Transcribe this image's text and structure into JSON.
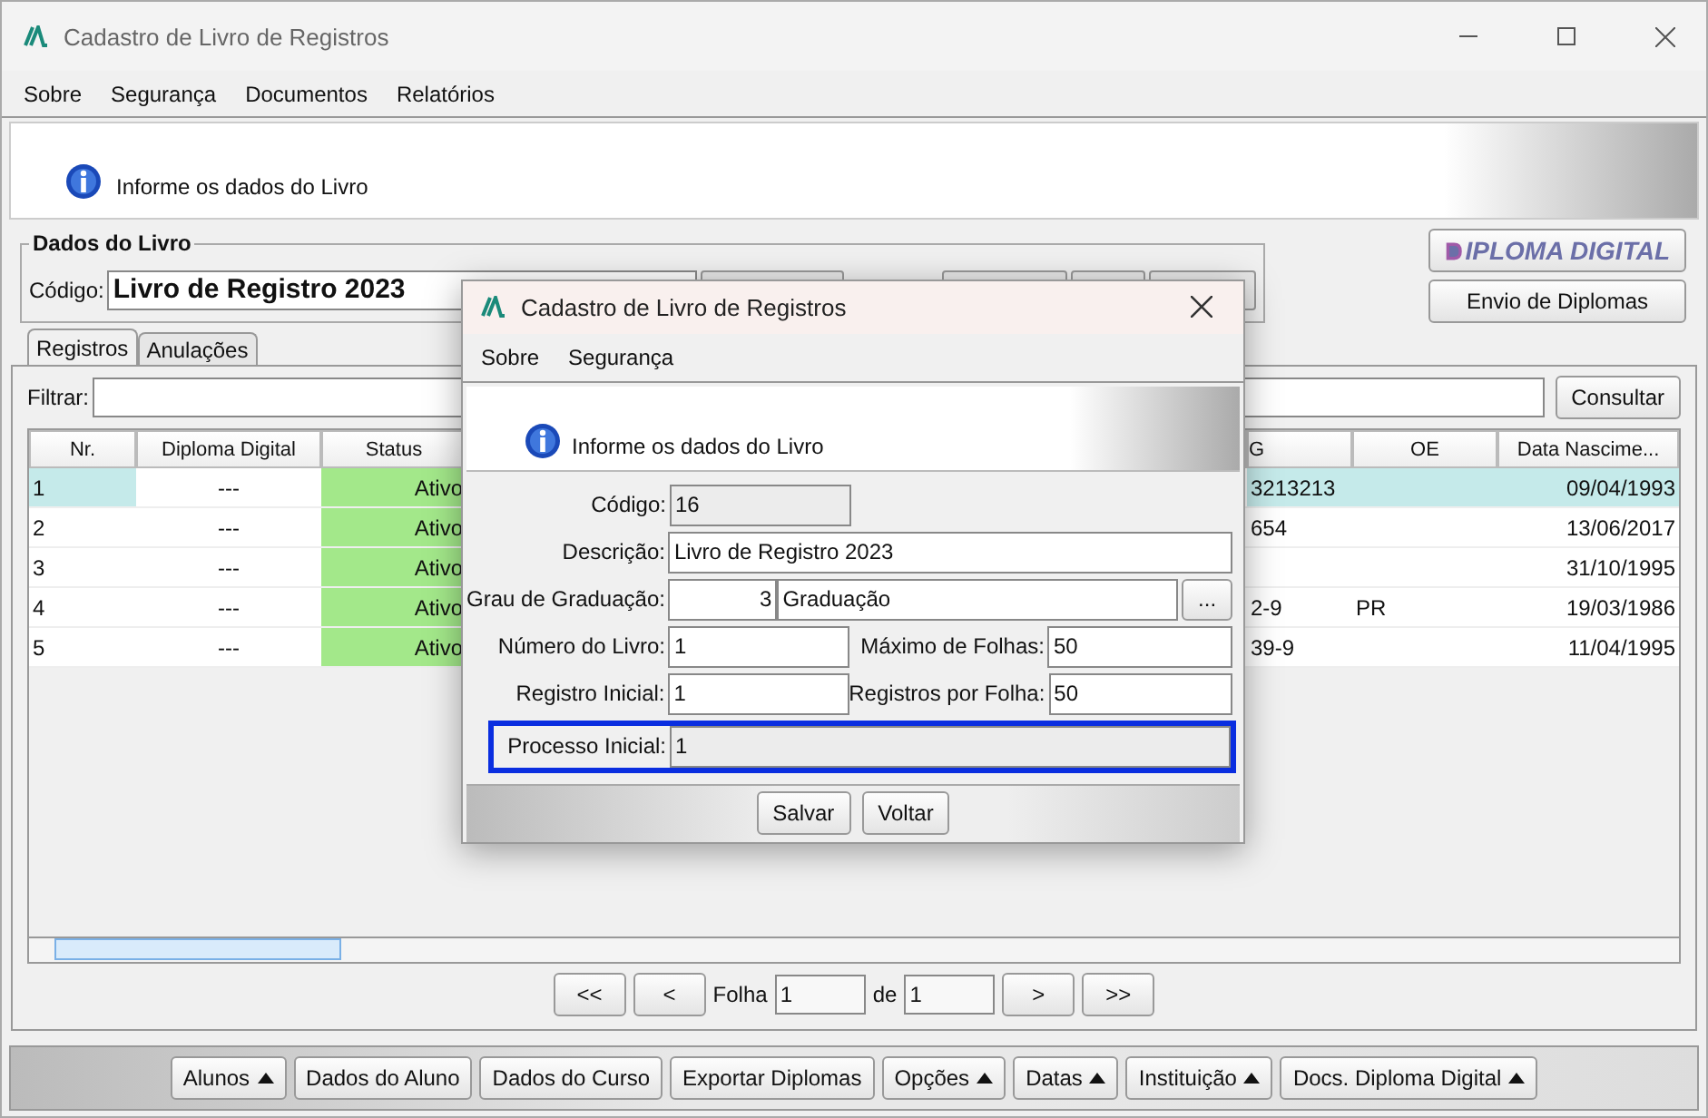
{
  "window": {
    "title": "Cadastro de Livro de Registros"
  },
  "menu": [
    "Sobre",
    "Segurança",
    "Documentos",
    "Relatórios"
  ],
  "banner": {
    "message": "Informe os dados do Livro"
  },
  "book_group": {
    "title": "Dados do Livro",
    "code_label": "Código:",
    "code_value": "Livro de Registro 2023"
  },
  "logo_button": {
    "label": "IPLOMA DIGITAL"
  },
  "send_button": {
    "label": "Envio de Diplomas"
  },
  "tabs": [
    {
      "label": "Registros",
      "selected": true
    },
    {
      "label": "Anulações",
      "selected": false
    }
  ],
  "filter": {
    "label": "Filtrar:",
    "button": "Consultar"
  },
  "table": {
    "columns": [
      "Nr.",
      "Diploma Digital",
      "Status",
      "G",
      "OE",
      "Data Nascime..."
    ],
    "rows": [
      {
        "selected": true,
        "cells": [
          "1",
          "---",
          "Ativo",
          "3213213",
          "",
          "09/04/1993"
        ]
      },
      {
        "selected": false,
        "cells": [
          "2",
          "---",
          "Ativo",
          "654",
          "",
          "13/06/2017"
        ]
      },
      {
        "selected": false,
        "cells": [
          "3",
          "---",
          "Ativo",
          "",
          "",
          "31/10/1995"
        ]
      },
      {
        "selected": false,
        "cells": [
          "4",
          "---",
          "Ativo",
          "2-9",
          "PR",
          "19/03/1986"
        ]
      },
      {
        "selected": false,
        "cells": [
          "5",
          "---",
          "Ativo",
          "39-9",
          "",
          "11/04/1995"
        ]
      }
    ]
  },
  "pagination": {
    "first": "<<",
    "prev": "<",
    "page_label": "Folha",
    "page": "1",
    "of_label": "de",
    "total": "1",
    "next": ">",
    "last": ">>"
  },
  "toolbar": [
    {
      "label": "Alunos",
      "dropdown": true
    },
    {
      "label": "Dados do Aluno",
      "dropdown": false
    },
    {
      "label": "Dados do Curso",
      "dropdown": false
    },
    {
      "label": "Exportar Diplomas",
      "dropdown": false
    },
    {
      "label": "Opções",
      "dropdown": true
    },
    {
      "label": "Datas",
      "dropdown": true
    },
    {
      "label": "Instituição",
      "dropdown": true
    },
    {
      "label": "Docs. Diploma Digital",
      "dropdown": true
    }
  ],
  "dialog": {
    "title": "Cadastro de Livro de Registros",
    "menu": [
      "Sobre",
      "Segurança"
    ],
    "banner": {
      "message": "Informe os dados do Livro"
    },
    "code": {
      "label": "Código:",
      "value": "16"
    },
    "description": {
      "label": "Descrição:",
      "value": "Livro de Registro 2023"
    },
    "degree": {
      "label": "Grau de Graduação:",
      "number": "3",
      "name": "Graduação",
      "button": "..."
    },
    "book_number": {
      "label": "Número do Livro:",
      "value": "1"
    },
    "max_sheets": {
      "label": "Máximo de Folhas:",
      "value": "50"
    },
    "initial_record": {
      "label": "Registro Inicial:",
      "value": "1"
    },
    "records_per_sheet": {
      "label": "Registros por Folha:",
      "value": "50"
    },
    "initial_process": {
      "label": "Processo Inicial:",
      "value": "1",
      "highlighted": true
    },
    "buttons": [
      "Salvar",
      "Voltar"
    ]
  }
}
